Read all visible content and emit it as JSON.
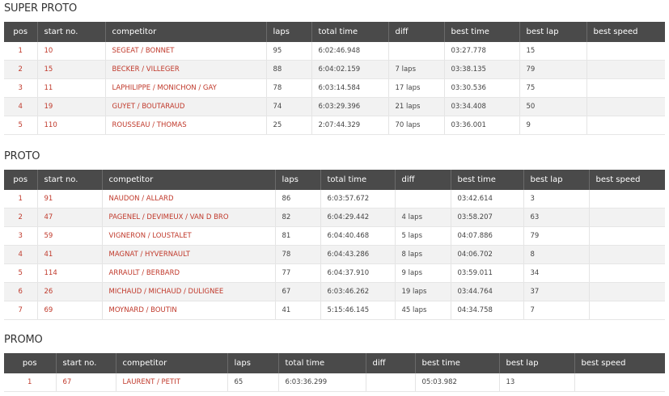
{
  "columns": [
    "pos",
    "start no.",
    "competitor",
    "laps",
    "total time",
    "diff",
    "best time",
    "best lap",
    "best speed"
  ],
  "sections": [
    {
      "title": "SUPER PROTO",
      "rows": [
        {
          "pos": "1",
          "start": "10",
          "competitor": "SEGEAT / BONNET",
          "laps": "95",
          "total": "6:02:46.948",
          "diff": "",
          "best_time": "03:27.778",
          "best_lap": "15",
          "best_speed": ""
        },
        {
          "pos": "2",
          "start": "15",
          "competitor": "BECKER / VILLEGER",
          "laps": "88",
          "total": "6:04:02.159",
          "diff": "7 laps",
          "best_time": "03:38.135",
          "best_lap": "79",
          "best_speed": ""
        },
        {
          "pos": "3",
          "start": "11",
          "competitor": "LAPHILIPPE / MONICHON / GAY",
          "laps": "78",
          "total": "6:03:14.584",
          "diff": "17 laps",
          "best_time": "03:30.536",
          "best_lap": "75",
          "best_speed": ""
        },
        {
          "pos": "4",
          "start": "19",
          "competitor": "GUYET / BOUTARAUD",
          "laps": "74",
          "total": "6:03:29.396",
          "diff": "21 laps",
          "best_time": "03:34.408",
          "best_lap": "50",
          "best_speed": ""
        },
        {
          "pos": "5",
          "start": "110",
          "competitor": "ROUSSEAU / THOMAS",
          "laps": "25",
          "total": "2:07:44.329",
          "diff": "70 laps",
          "best_time": "03:36.001",
          "best_lap": "9",
          "best_speed": ""
        }
      ]
    },
    {
      "title": "PROTO",
      "rows": [
        {
          "pos": "1",
          "start": "91",
          "competitor": "NAUDON / ALLARD",
          "laps": "86",
          "total": "6:03:57.672",
          "diff": "",
          "best_time": "03:42.614",
          "best_lap": "3",
          "best_speed": ""
        },
        {
          "pos": "2",
          "start": "47",
          "competitor": "PAGENEL / DEVIMEUX / VAN D BRO",
          "laps": "82",
          "total": "6:04:29.442",
          "diff": "4 laps",
          "best_time": "03:58.207",
          "best_lap": "63",
          "best_speed": ""
        },
        {
          "pos": "3",
          "start": "59",
          "competitor": "VIGNERON / LOUSTALET",
          "laps": "81",
          "total": "6:04:40.468",
          "diff": "5 laps",
          "best_time": "04:07.886",
          "best_lap": "79",
          "best_speed": ""
        },
        {
          "pos": "4",
          "start": "41",
          "competitor": "MAGNAT / HYVERNAULT",
          "laps": "78",
          "total": "6:04:43.286",
          "diff": "8 laps",
          "best_time": "04:06.702",
          "best_lap": "8",
          "best_speed": ""
        },
        {
          "pos": "5",
          "start": "114",
          "competitor": "ARRAULT / BERBARD",
          "laps": "77",
          "total": "6:04:37.910",
          "diff": "9 laps",
          "best_time": "03:59.011",
          "best_lap": "34",
          "best_speed": ""
        },
        {
          "pos": "6",
          "start": "26",
          "competitor": "MICHAUD / MICHAUD / DULIGNEE",
          "laps": "67",
          "total": "6:03:46.262",
          "diff": "19 laps",
          "best_time": "03:44.764",
          "best_lap": "37",
          "best_speed": ""
        },
        {
          "pos": "7",
          "start": "69",
          "competitor": "MOYNARD / BOUTIN",
          "laps": "41",
          "total": "5:15:46.145",
          "diff": "45 laps",
          "best_time": "04:34.758",
          "best_lap": "7",
          "best_speed": ""
        }
      ]
    },
    {
      "title": "PROMO",
      "rows": [
        {
          "pos": "1",
          "start": "67",
          "competitor": "LAURENT / PETIT",
          "laps": "65",
          "total": "6:03:36.299",
          "diff": "",
          "best_time": "05:03.982",
          "best_lap": "13",
          "best_speed": ""
        }
      ]
    }
  ],
  "colors": {
    "header_bg": "#4a4a4a",
    "accent": "#c0392b",
    "zebra": "#f2f2f2"
  }
}
